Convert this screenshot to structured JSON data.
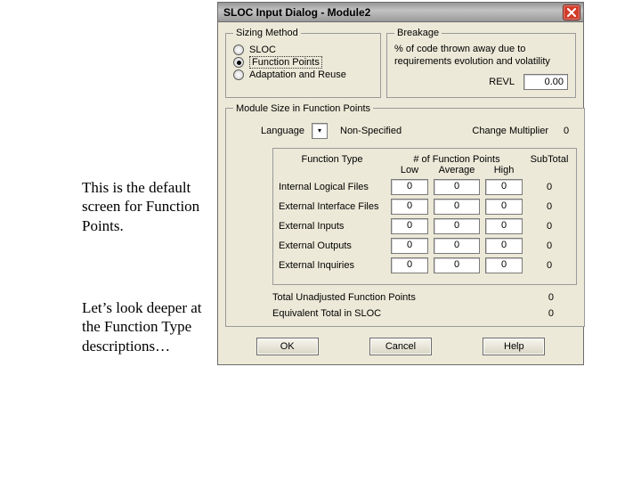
{
  "annotations": {
    "p1": "This is the default screen for Function Points.",
    "p2": "Let’s look deeper at the Function Type descriptions…"
  },
  "window": {
    "title": "SLOC Input Dialog - Module2"
  },
  "sizing": {
    "legend": "Sizing Method",
    "opt_sloc": "SLOC",
    "opt_fp": "Function Points",
    "opt_ar": "Adaptation and Reuse",
    "selected": "fp"
  },
  "breakage": {
    "legend": "Breakage",
    "desc": "% of code thrown away due to requirements evolution and volatility",
    "revl_label": "REVL",
    "revl_value": "0.00"
  },
  "fp": {
    "legend": "Module Size in Function Points",
    "lang_label": "Language",
    "lang_value": "Non-Specified",
    "cm_label": "Change Multiplier",
    "cm_value": "0",
    "ft_hdr": "Function Type",
    "fp_hdr": "# of Function Points",
    "sub_hdr": "SubTotal",
    "col_low": "Low",
    "col_avg": "Average",
    "col_high": "High",
    "rows": [
      {
        "label": "Internal Logical Files",
        "low": "0",
        "avg": "0",
        "high": "0",
        "sub": "0"
      },
      {
        "label": "External Interface Files",
        "low": "0",
        "avg": "0",
        "high": "0",
        "sub": "0"
      },
      {
        "label": "External Inputs",
        "low": "0",
        "avg": "0",
        "high": "0",
        "sub": "0"
      },
      {
        "label": "External Outputs",
        "low": "0",
        "avg": "0",
        "high": "0",
        "sub": "0"
      },
      {
        "label": "External Inquiries",
        "low": "0",
        "avg": "0",
        "high": "0",
        "sub": "0"
      }
    ],
    "total_ufp_label": "Total Unadjusted Function Points",
    "total_ufp_value": "0",
    "total_sloc_label": "Equivalent Total in SLOC",
    "total_sloc_value": "0"
  },
  "buttons": {
    "ok": "OK",
    "cancel": "Cancel",
    "help": "Help"
  }
}
